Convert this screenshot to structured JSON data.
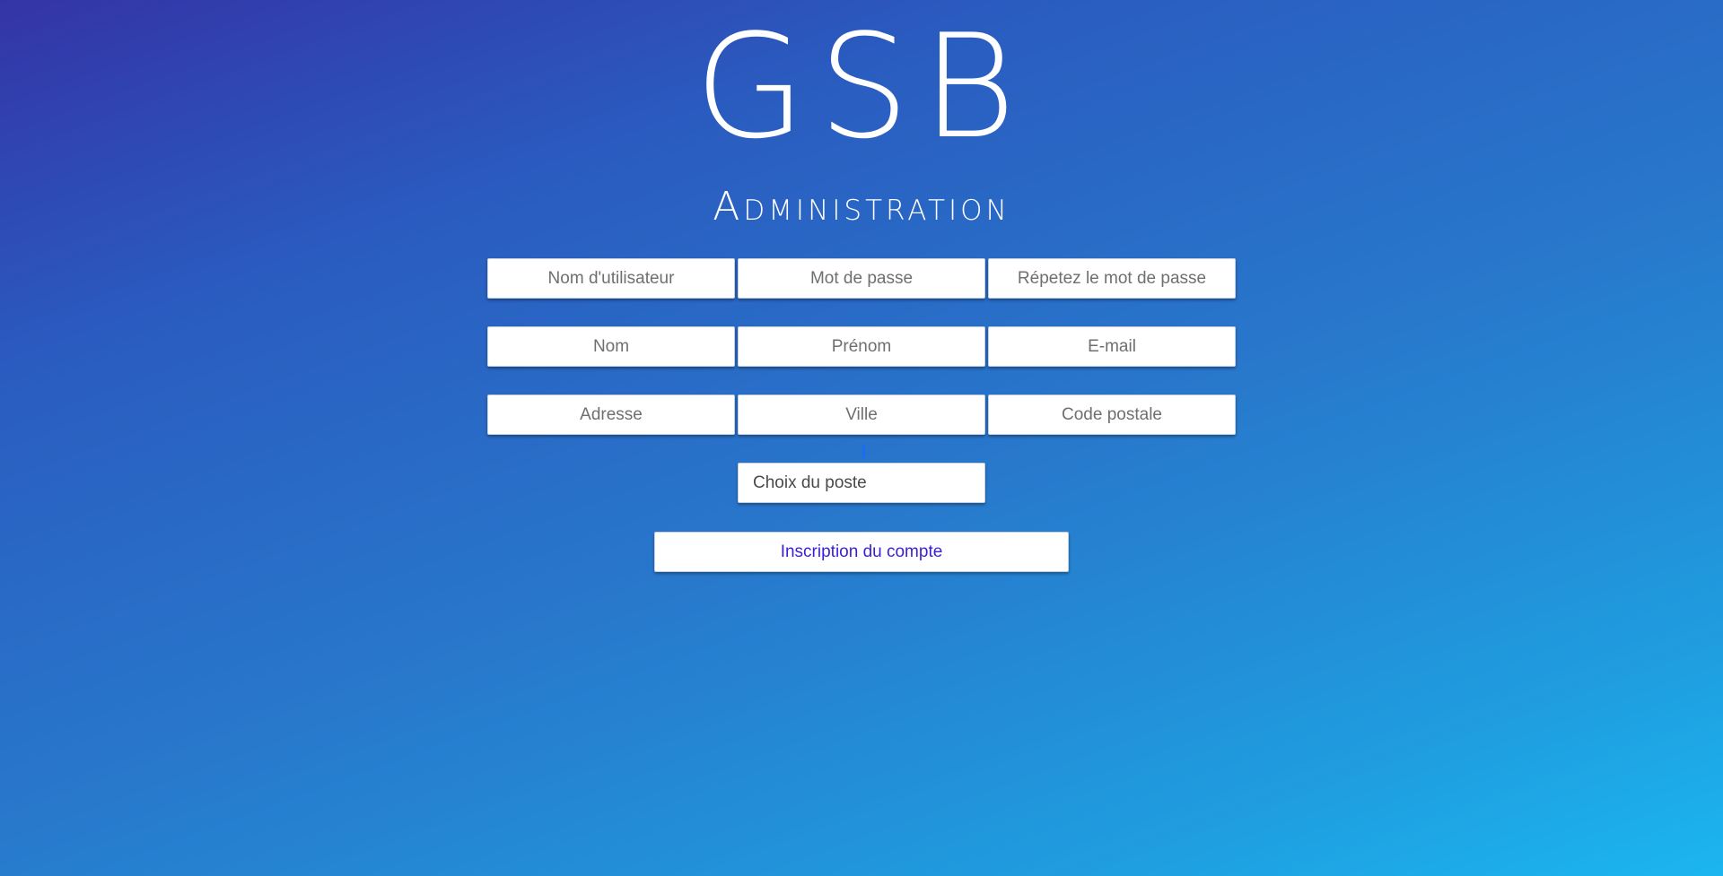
{
  "logo": {
    "text": "GSB"
  },
  "page": {
    "title": "Administration"
  },
  "form": {
    "fields": {
      "username": {
        "placeholder": "Nom d'utilisateur",
        "value": ""
      },
      "password": {
        "placeholder": "Mot de passe",
        "value": ""
      },
      "password_repeat": {
        "placeholder": "Répetez le mot de passe",
        "value": ""
      },
      "last_name": {
        "placeholder": "Nom",
        "value": ""
      },
      "first_name": {
        "placeholder": "Prénom",
        "value": ""
      },
      "email": {
        "placeholder": "E-mail",
        "value": ""
      },
      "address": {
        "placeholder": "Adresse",
        "value": ""
      },
      "city": {
        "placeholder": "Ville",
        "value": ""
      },
      "postal_code": {
        "placeholder": "Code postale",
        "value": ""
      }
    },
    "position_select": {
      "selected_label": "Choix du poste"
    },
    "submit_label": "Inscription du compte"
  }
}
